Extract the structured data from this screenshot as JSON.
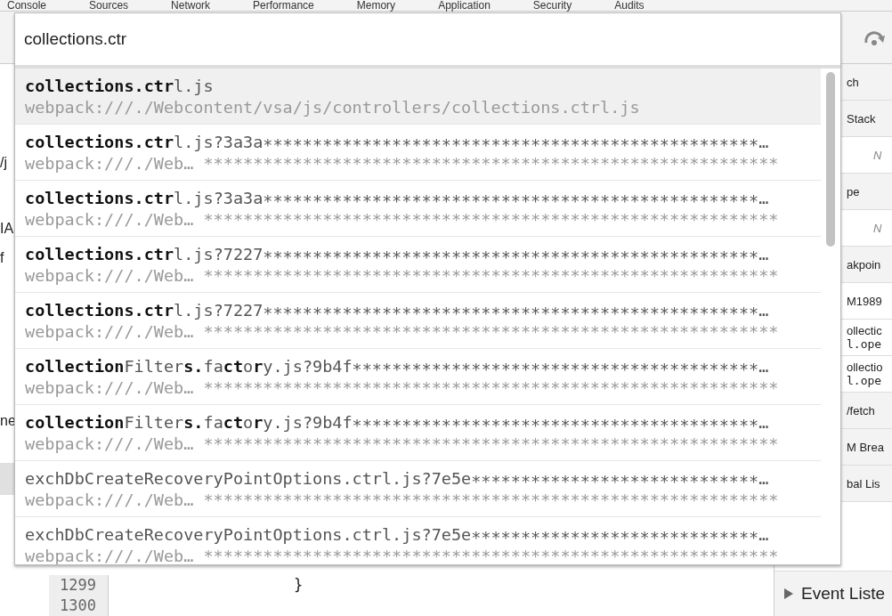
{
  "panel_tabs": [
    "Console",
    "Sources",
    "Network",
    "Performance",
    "Memory",
    "Application",
    "Security",
    "Audits"
  ],
  "left_fragments": [
    "/j",
    "IA",
    "f",
    "ne"
  ],
  "code_lines": [
    {
      "number": "1299",
      "text": "}"
    },
    {
      "number": "1300"
    }
  ],
  "sidebar": [
    {
      "kind": "header",
      "text": "ch"
    },
    {
      "kind": "header",
      "text": "Stack"
    },
    {
      "kind": "italic",
      "text": "N"
    },
    {
      "kind": "header",
      "text": "pe"
    },
    {
      "kind": "italic",
      "text": "N"
    },
    {
      "kind": "header",
      "text": "akpoin"
    },
    {
      "kind": "item",
      "text": "M1989"
    },
    {
      "kind": "item",
      "text": "ollectic",
      "detail": "l.ope"
    },
    {
      "kind": "item",
      "text": "ollectio",
      "detail": "l.ope"
    },
    {
      "kind": "header",
      "text": "/fetch"
    },
    {
      "kind": "header",
      "text": "M Brea"
    },
    {
      "kind": "header",
      "text": "bal Lis"
    }
  ],
  "sidebar_section": {
    "label": "Event Liste",
    "expanded": false
  },
  "quick_open": {
    "query": "collections.ctr",
    "results": [
      {
        "title": "**collections.ctr**l.js",
        "path": "webpack:///./Webcontent/vsa/js/controllers/collections.ctrl.js",
        "selected": true
      },
      {
        "title": "**collections.ctr**l.js?3a3a∗∗∗∗∗∗∗∗∗∗∗∗∗∗∗∗∗∗∗∗∗∗∗∗∗∗∗∗∗∗∗∗∗∗∗∗∗∗∗∗∗∗∗∗∗∗∗∗∗∗…",
        "path": "webpack:///./Web… **********************************************************",
        "selected": false
      },
      {
        "title": "**collections.ctr**l.js?3a3a∗∗∗∗∗∗∗∗∗∗∗∗∗∗∗∗∗∗∗∗∗∗∗∗∗∗∗∗∗∗∗∗∗∗∗∗∗∗∗∗∗∗∗∗∗∗∗∗∗∗…",
        "path": "webpack:///./Web… **********************************************************",
        "selected": false
      },
      {
        "title": "**collections.ctr**l.js?7227∗∗∗∗∗∗∗∗∗∗∗∗∗∗∗∗∗∗∗∗∗∗∗∗∗∗∗∗∗∗∗∗∗∗∗∗∗∗∗∗∗∗∗∗∗∗∗∗∗∗…",
        "path": "webpack:///./Web… **********************************************************",
        "selected": false
      },
      {
        "title": "**collections.ctr**l.js?7227∗∗∗∗∗∗∗∗∗∗∗∗∗∗∗∗∗∗∗∗∗∗∗∗∗∗∗∗∗∗∗∗∗∗∗∗∗∗∗∗∗∗∗∗∗∗∗∗∗∗…",
        "path": "webpack:///./Web… **********************************************************",
        "selected": false
      },
      {
        "title": "**collection**Filter**s.**fa**ct**o**r**y.js?9b4f∗∗∗∗∗∗∗∗∗∗∗∗∗∗∗∗∗∗∗∗∗∗∗∗∗∗∗∗∗∗∗∗∗∗∗∗∗∗∗∗∗…",
        "path": "webpack:///./Web… **********************************************************",
        "selected": false
      },
      {
        "title": "**collection**Filter**s.**fa**ct**o**r**y.js?9b4f∗∗∗∗∗∗∗∗∗∗∗∗∗∗∗∗∗∗∗∗∗∗∗∗∗∗∗∗∗∗∗∗∗∗∗∗∗∗∗∗∗…",
        "path": "webpack:///./Web… **********************************************************",
        "selected": false
      },
      {
        "title": "exchDbCreateRecoveryPointOptions.ctrl.js?7e5e∗∗∗∗∗∗∗∗∗∗∗∗∗∗∗∗∗∗∗∗∗∗∗∗∗∗∗∗∗…",
        "path": "webpack:///./Web… **********************************************************",
        "selected": false
      },
      {
        "title": "exchDbCreateRecoveryPointOptions.ctrl.js?7e5e∗∗∗∗∗∗∗∗∗∗∗∗∗∗∗∗∗∗∗∗∗∗∗∗∗∗∗∗∗…",
        "path": "webpack:///./Web… **********************************************************",
        "selected": false
      }
    ]
  }
}
